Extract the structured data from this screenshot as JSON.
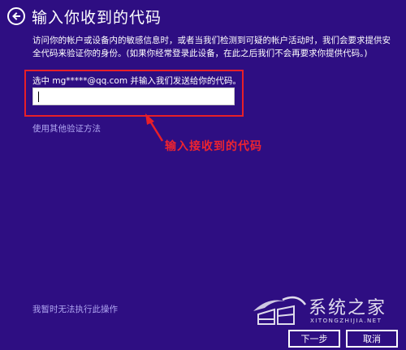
{
  "header": {
    "title": "输入你收到的代码",
    "back_icon": "back-arrow-icon"
  },
  "description": "访问你的帐户或设备内的敏感信息时，或者当我们检测到可疑的帐户活动时，我们会要求提供安全代码来验证你的身份。(如果你经常登录此设备，在此之后我们不会再要求你提供代码。)",
  "form": {
    "prompt": "选中 mg*****@qq.com 并输入我们发送给你的代码。",
    "code_value": "",
    "code_placeholder": ""
  },
  "links": {
    "other_method": "使用其他验证方法",
    "cant_do": "我暂时无法执行此操作"
  },
  "annotation": {
    "text": "输入接收到的代码",
    "color": "#ee2430"
  },
  "buttons": {
    "next": "下一步",
    "cancel": "取消"
  },
  "watermark": {
    "cn": "系统之家",
    "en": "XITONGZHIJIA.NET"
  },
  "colors": {
    "background": "#2e0e82",
    "link": "#b0a6f2",
    "highlight": "#e81f28"
  }
}
